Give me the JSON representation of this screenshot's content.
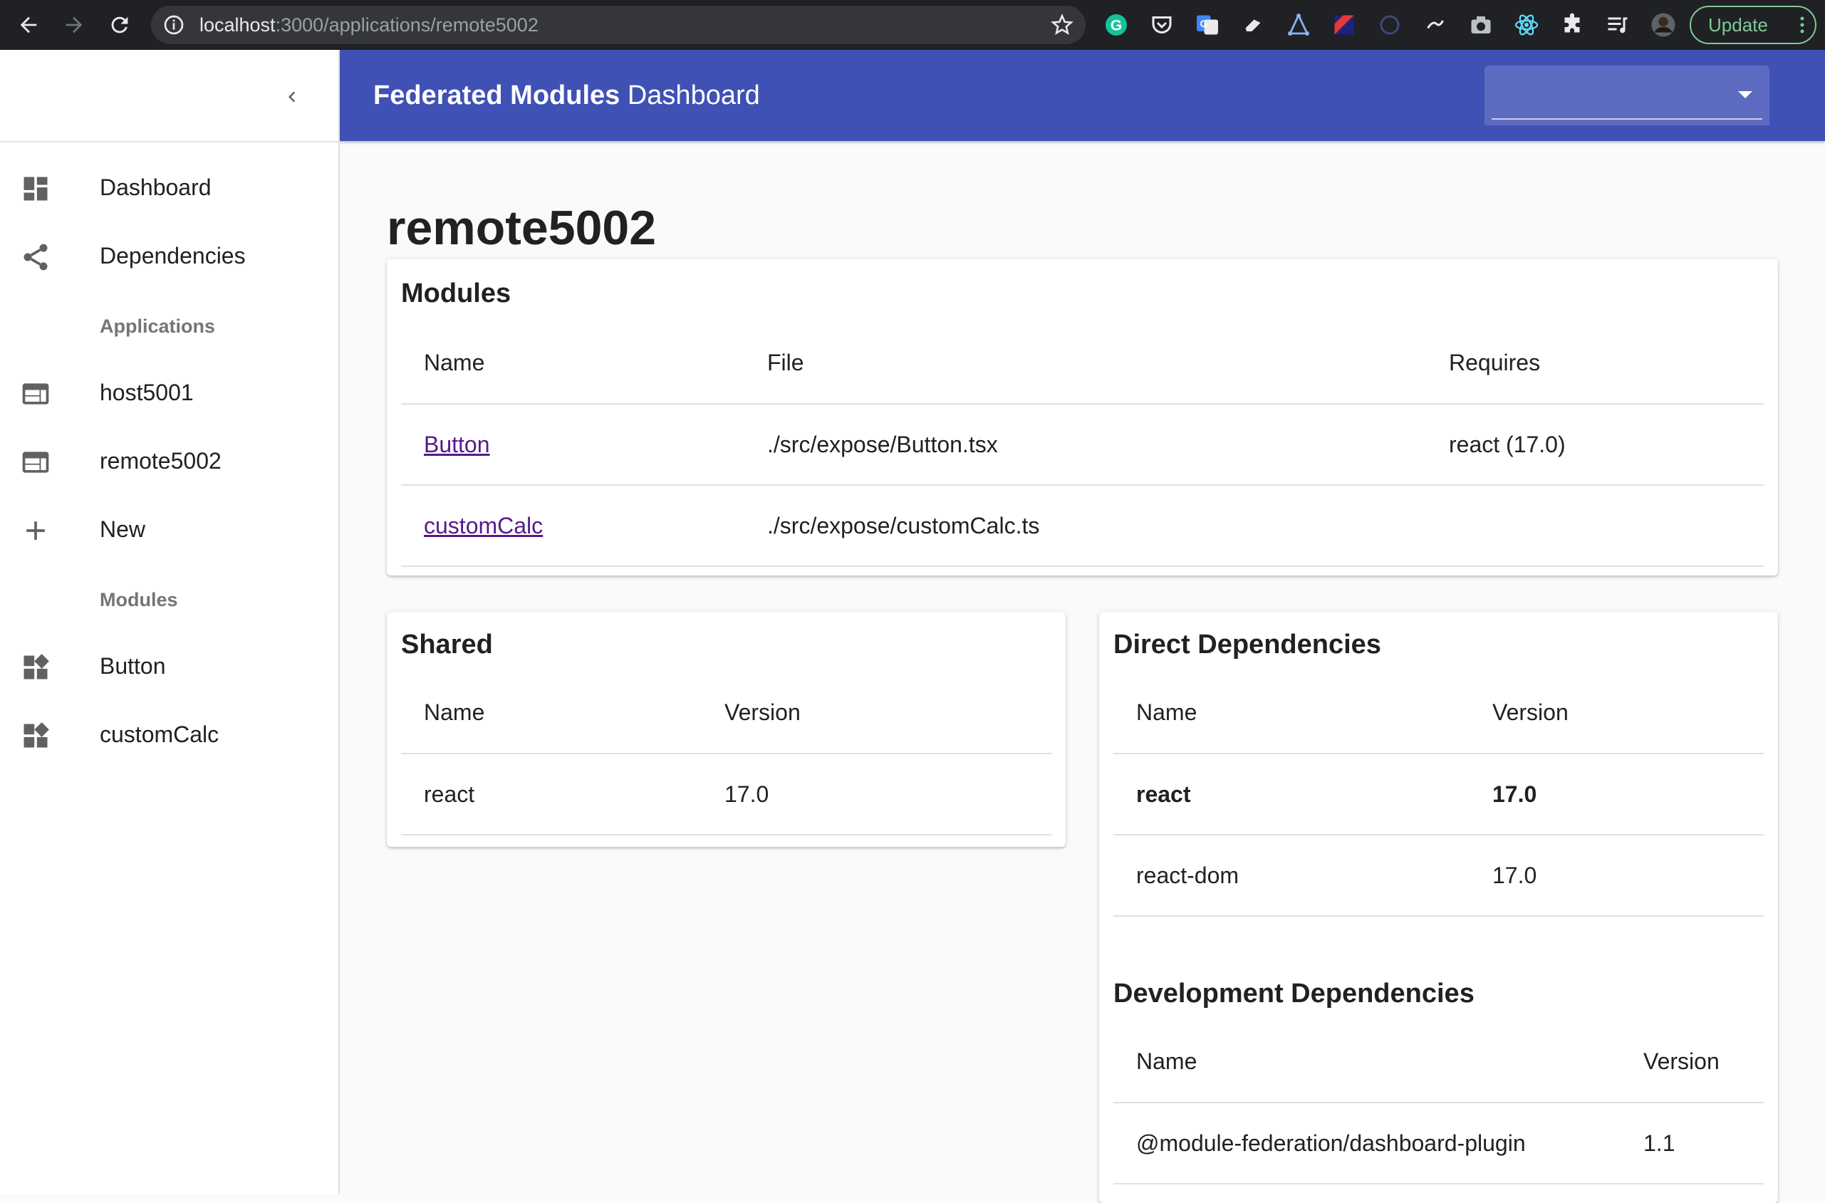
{
  "browser": {
    "url_host": "localhost",
    "url_path": ":3000/applications/remote5002",
    "update_label": "Update"
  },
  "app": {
    "title_bold": "Federated Modules",
    "title_light": "Dashboard",
    "selector_value": ""
  },
  "sidebar": {
    "items": [
      {
        "label": "Dashboard",
        "icon": "dashboard-icon"
      },
      {
        "label": "Dependencies",
        "icon": "share-icon"
      }
    ],
    "applications_header": "Applications",
    "applications": [
      {
        "label": "host5001",
        "icon": "web-icon"
      },
      {
        "label": "remote5002",
        "icon": "web-icon"
      },
      {
        "label": "New",
        "icon": "add-icon"
      }
    ],
    "modules_header": "Modules",
    "modules": [
      {
        "label": "Button",
        "icon": "widgets-icon"
      },
      {
        "label": "customCalc",
        "icon": "widgets-icon"
      }
    ]
  },
  "page": {
    "title": "remote5002"
  },
  "modules_card": {
    "title": "Modules",
    "columns": [
      "Name",
      "File",
      "Requires"
    ],
    "rows": [
      {
        "name": "Button",
        "file": "./src/expose/Button.tsx",
        "requires": "react (17.0)"
      },
      {
        "name": "customCalc",
        "file": "./src/expose/customCalc.ts",
        "requires": ""
      }
    ]
  },
  "shared_card": {
    "title": "Shared",
    "columns": [
      "Name",
      "Version"
    ],
    "rows": [
      {
        "name": "react",
        "version": "17.0"
      }
    ]
  },
  "direct_deps": {
    "title": "Direct Dependencies",
    "columns": [
      "Name",
      "Version"
    ],
    "rows": [
      {
        "name": "react",
        "version": "17.0",
        "bold": true
      },
      {
        "name": "react-dom",
        "version": "17.0",
        "bold": false
      }
    ]
  },
  "dev_deps": {
    "title": "Development Dependencies",
    "columns": [
      "Name",
      "Version"
    ],
    "rows": [
      {
        "name": "@module-federation/dashboard-plugin",
        "version": "1.1"
      }
    ]
  },
  "colors": {
    "appbar": "#3f51b5",
    "link": "#551a8b",
    "chrome": "#202124"
  }
}
